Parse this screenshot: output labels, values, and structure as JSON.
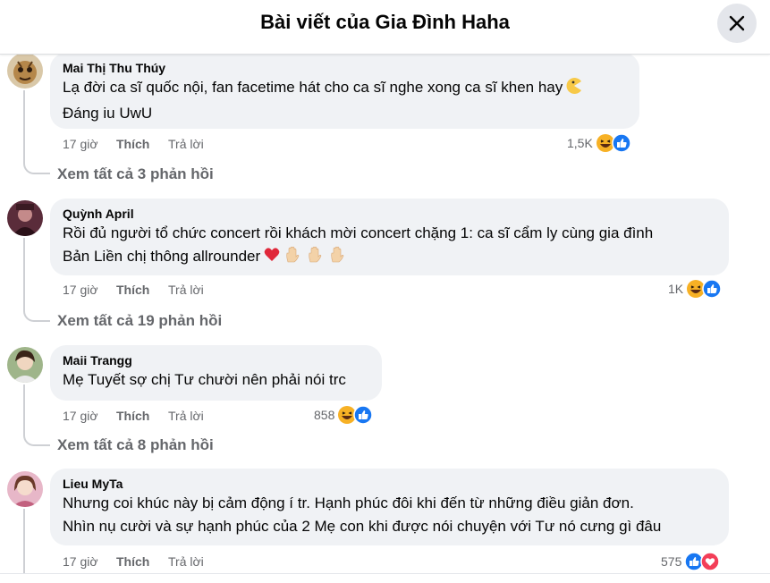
{
  "header": {
    "title": "Bài viết của Gia Đình Haha",
    "close_icon": "close-icon"
  },
  "comments": [
    {
      "author": "Mai Thị Thu Thúy",
      "lines": [
        "Lạ đời ca sĩ quốc nội, fan facetime hát cho ca sĩ nghe xong ca sĩ khen hay",
        "Đáng iu UwU"
      ],
      "inline_emoji": "pacman-emoji",
      "time": "17 giờ",
      "like": "Thích",
      "reply": "Trả lời",
      "reaction_count": "1,5K",
      "reactions": [
        "haha",
        "like"
      ],
      "view_replies": "Xem tất cả 3 phản hồi"
    },
    {
      "author": "Quỳnh April",
      "lines": [
        "Rồi đủ người tổ chức concert rồi khách mời concert chặng 1: ca sĩ cẩm ly cùng gia đình",
        "Bản Liền chị thông allrounder"
      ],
      "inline_emoji": "heart-and-raised-hands-emoji",
      "time": "17 giờ",
      "like": "Thích",
      "reply": "Trả lời",
      "reaction_count": "1K",
      "reactions": [
        "haha",
        "like"
      ],
      "view_replies": "Xem tất cả 19 phản hồi"
    },
    {
      "author": "Maii Trangg",
      "lines": [
        "Mẹ Tuyết sợ chị Tư chười nên phải nói trc"
      ],
      "time": "17 giờ",
      "like": "Thích",
      "reply": "Trả lời",
      "reaction_count": "858",
      "reactions": [
        "haha",
        "like"
      ],
      "view_replies": "Xem tất cả 8 phản hồi"
    },
    {
      "author": "Lieu MyTa",
      "lines": [
        "Nhưng coi khúc này bị cảm động í tr. Hạnh phúc đôi khi đến từ những điều giản đơn.",
        "Nhìn nụ cười và sự hạnh phúc của 2 Mẹ con khi được nói chuyện với Tư nó cưng gì đâu"
      ],
      "time": "17 giờ",
      "like": "Thích",
      "reply": "Trả lời",
      "reaction_count": "575",
      "reactions": [
        "like",
        "love"
      ]
    }
  ],
  "colors": {
    "bubble": "#f0f2f5",
    "secondary_text": "#65676b",
    "like_blue": "#1877f2",
    "haha_yellow": "#f7b125",
    "love_red": "#f33e58"
  }
}
